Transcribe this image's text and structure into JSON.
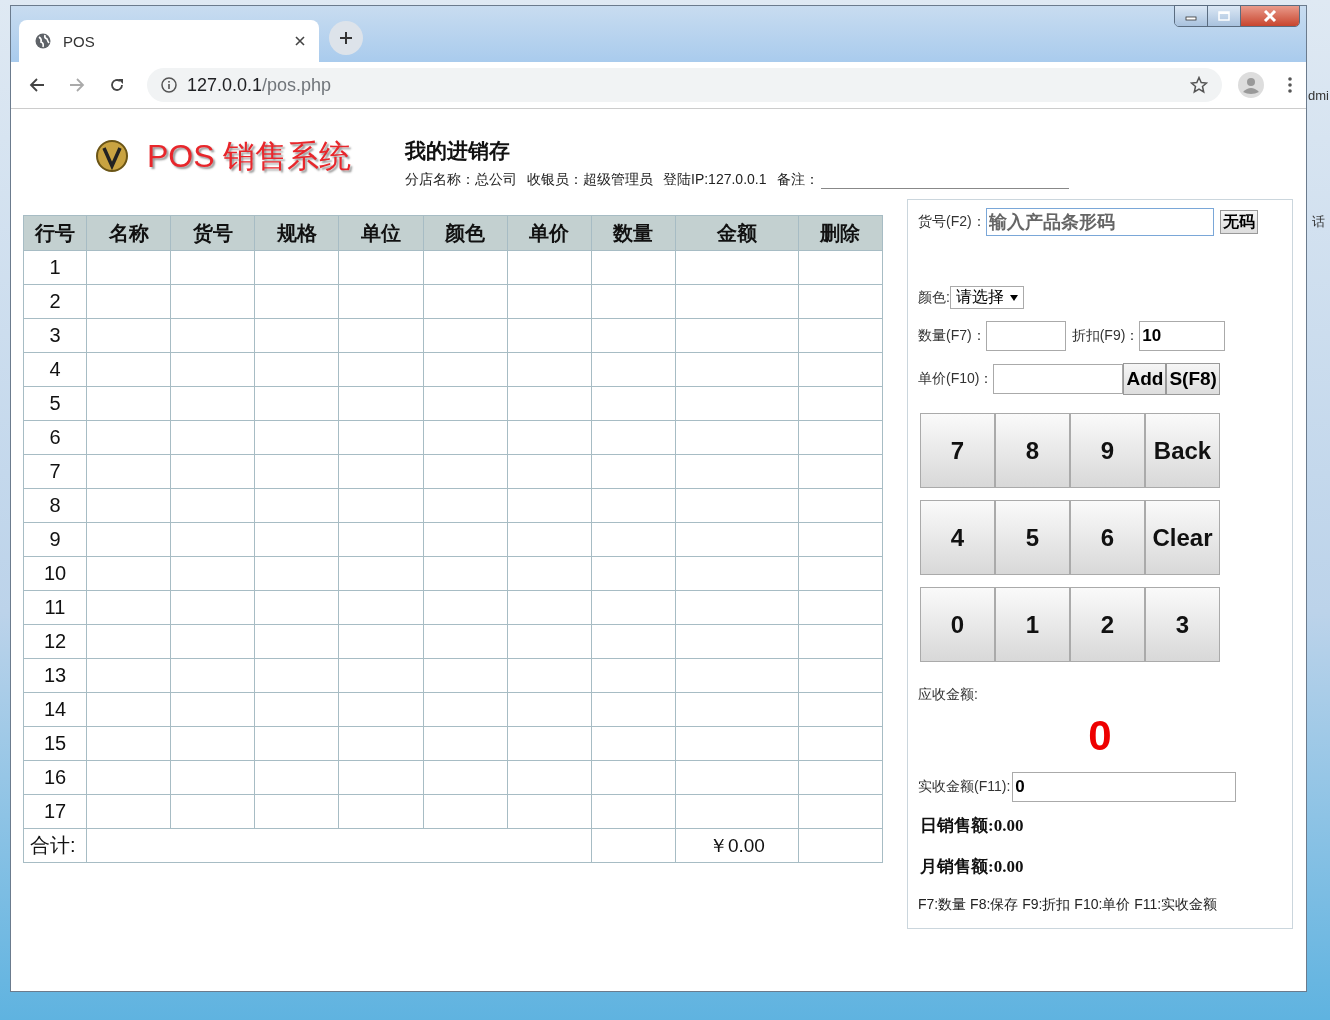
{
  "desktop": {
    "fragments": [
      "dmi",
      "话"
    ]
  },
  "browser": {
    "tab": {
      "title": "POS"
    },
    "url": {
      "host": "127.0.0.1",
      "path": "/pos.php"
    }
  },
  "header": {
    "logo_text": "POS 销售系统",
    "title": "我的进销存",
    "info": [
      "分店名称：总公司",
      "收银员：超级管理员",
      "登陆IP:127.0.0.1",
      "备注："
    ]
  },
  "table": {
    "columns": [
      "行号",
      "名称",
      "货号",
      "规格",
      "单位",
      "颜色",
      "单价",
      "数量",
      "金额",
      "删除"
    ],
    "rows": [
      "1",
      "2",
      "3",
      "4",
      "5",
      "6",
      "7",
      "8",
      "9",
      "10",
      "11",
      "12",
      "13",
      "14",
      "15",
      "16",
      "17"
    ],
    "footer": {
      "label": "合计:",
      "amount": "￥0.00"
    }
  },
  "panel": {
    "barcode": {
      "label": "货号(F2)：",
      "placeholder": "输入产品条形码",
      "button": "无码"
    },
    "color": {
      "label": "颜色:",
      "value": "请选择"
    },
    "quantity": {
      "label": "数量(F7)："
    },
    "discount": {
      "label": "折扣(F9)：",
      "value": "10"
    },
    "price": {
      "label": "单价(F10)：",
      "buttons": [
        "Add",
        "S(F8)"
      ]
    },
    "keypad": [
      [
        "7",
        "8",
        "9",
        "Back"
      ],
      [
        "4",
        "5",
        "6",
        "Clear"
      ],
      [
        "0",
        "1",
        "2",
        "3"
      ]
    ],
    "receivable": {
      "label": "应收金额:",
      "amount": "0"
    },
    "received": {
      "label": "实收金额(F11):",
      "value": "0"
    },
    "daily_sales": "日销售额:0.00",
    "monthly_sales": "月销售额:0.00",
    "shortcuts": "F7:数量 F8:保存 F9:折扣 F10:单价 F11:实收金额"
  }
}
